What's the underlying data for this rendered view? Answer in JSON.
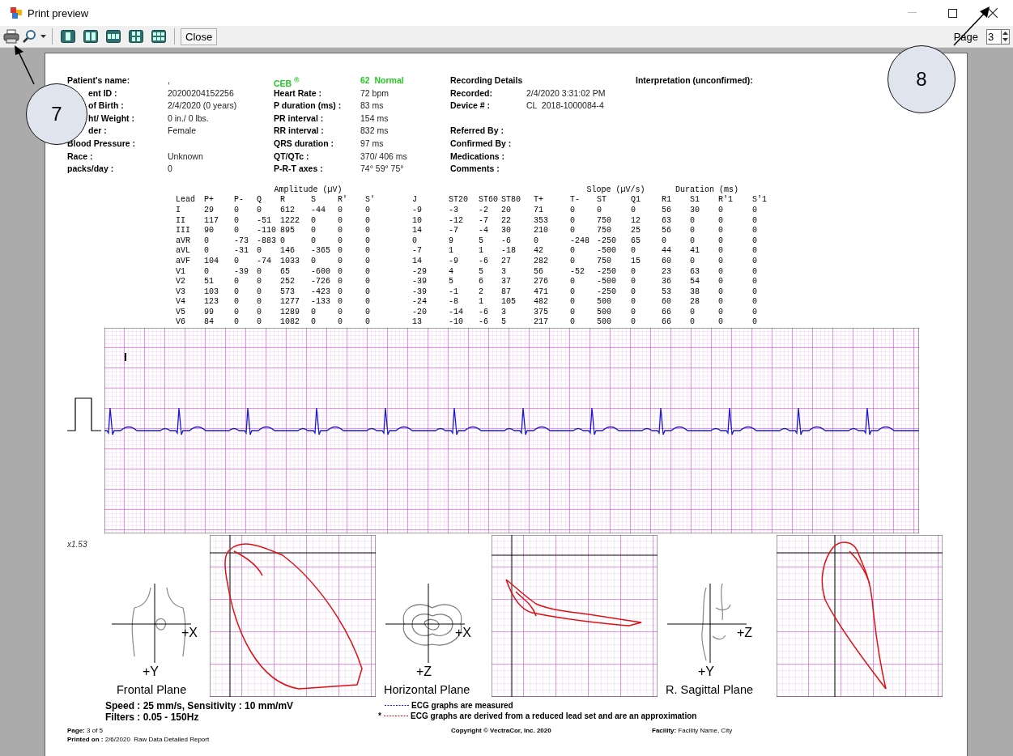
{
  "window": {
    "title": "Print preview"
  },
  "toolbar": {
    "close_label": "Close",
    "page_label": "Page",
    "page_value": "3"
  },
  "patient": {
    "rows": [
      {
        "label": "Patient's name:",
        "value": ",",
        "covered": false
      },
      {
        "label": "ent ID :",
        "value": "20200204152256",
        "covered": true
      },
      {
        "label": "of Birth :",
        "value": "2/4/2020 (0 years)",
        "covered": true
      },
      {
        "label": "ht/ Weight :",
        "value": "0 in./ 0 lbs.",
        "covered": true
      },
      {
        "label": "der :",
        "value": "Female",
        "covered": true
      },
      {
        "label": "Blood Pressure :",
        "value": "",
        "covered": false
      },
      {
        "label": "Race :",
        "value": "Unknown",
        "covered": false
      },
      {
        "label": "packs/day :",
        "value": "0",
        "covered": false
      }
    ]
  },
  "ecg_summary": {
    "title": "CEB $^{®}$",
    "status": "62  Normal",
    "rows": [
      {
        "label": "Heart Rate :",
        "value": "72 bpm"
      },
      {
        "label": "P duration (ms) :",
        "value": "83 ms"
      },
      {
        "label": "PR interval :",
        "value": "154 ms"
      },
      {
        "label": "RR interval :",
        "value": "832 ms"
      },
      {
        "label": "QRS duration :",
        "value": "97 ms"
      },
      {
        "label": "QT/QTc :",
        "value": "370/ 406 ms"
      },
      {
        "label": "P-R-T axes :",
        "value": "74° 59° 75°"
      }
    ]
  },
  "recording": {
    "title": "Recording Details",
    "rows": [
      {
        "label": "Recorded:",
        "value": "2/4/2020 3:31:02 PM"
      },
      {
        "label": "Device # :",
        "value": "CL  2018-1000084-4"
      }
    ],
    "other_labels": [
      "Referred By :",
      "Confirmed By :",
      "Medications :",
      "Comments :"
    ]
  },
  "interpretation": {
    "title": "Interpretation (unconfirmed):"
  },
  "table": {
    "groups": [
      "Amplitude (µV)",
      "Slope (µV/s)",
      "Duration (ms)"
    ],
    "columns": [
      "Lead",
      "P+",
      "P-",
      "Q",
      "R",
      "S",
      "R'",
      "S'",
      "J",
      "ST20",
      "ST60",
      "ST80",
      "T+",
      "T-",
      "ST",
      "Q1",
      "R1",
      "S1",
      "R'1",
      "S'1"
    ],
    "rows": [
      [
        "I",
        "29",
        "0",
        "0",
        "612",
        "-44",
        "0",
        "0",
        "-9",
        "-3",
        "-2",
        "20",
        "71",
        "0",
        "0",
        "0",
        "56",
        "30",
        "0",
        "0"
      ],
      [
        "II",
        "117",
        "0",
        "-51",
        "1222",
        "0",
        "0",
        "0",
        "10",
        "-12",
        "-7",
        "22",
        "353",
        "0",
        "750",
        "12",
        "63",
        "0",
        "0",
        "0"
      ],
      [
        "III",
        "90",
        "0",
        "-110",
        "895",
        "0",
        "0",
        "0",
        "14",
        "-7",
        "-4",
        "30",
        "210",
        "0",
        "750",
        "25",
        "56",
        "0",
        "0",
        "0"
      ],
      [
        "aVR",
        "0",
        "-73",
        "-883",
        "0",
        "0",
        "0",
        "0",
        "0",
        "9",
        "5",
        "-6",
        "0",
        "-248",
        "-250",
        "65",
        "0",
        "0",
        "0",
        "0"
      ],
      [
        "aVL",
        "0",
        "-31",
        "0",
        "146",
        "-365",
        "0",
        "0",
        "-7",
        "1",
        "1",
        "-18",
        "42",
        "0",
        "-500",
        "0",
        "44",
        "41",
        "0",
        "0"
      ],
      [
        "aVF",
        "104",
        "0",
        "-74",
        "1033",
        "0",
        "0",
        "0",
        "14",
        "-9",
        "-6",
        "27",
        "282",
        "0",
        "750",
        "15",
        "60",
        "0",
        "0",
        "0"
      ],
      [
        "V1",
        "0",
        "-39",
        "0",
        "65",
        "-600",
        "0",
        "0",
        "-29",
        "4",
        "5",
        "3",
        "56",
        "-52",
        "-250",
        "0",
        "23",
        "63",
        "0",
        "0"
      ],
      [
        "V2",
        "51",
        "0",
        "0",
        "252",
        "-726",
        "0",
        "0",
        "-39",
        "5",
        "6",
        "37",
        "276",
        "0",
        "-500",
        "0",
        "36",
        "54",
        "0",
        "0"
      ],
      [
        "V3",
        "103",
        "0",
        "0",
        "573",
        "-423",
        "0",
        "0",
        "-39",
        "-1",
        "2",
        "87",
        "471",
        "0",
        "-250",
        "0",
        "53",
        "38",
        "0",
        "0"
      ],
      [
        "V4",
        "123",
        "0",
        "0",
        "1277",
        "-133",
        "0",
        "0",
        "-24",
        "-8",
        "1",
        "105",
        "482",
        "0",
        "500",
        "0",
        "60",
        "28",
        "0",
        "0"
      ],
      [
        "V5",
        "99",
        "0",
        "0",
        "1289",
        "0",
        "0",
        "0",
        "-20",
        "-14",
        "-6",
        "3",
        "375",
        "0",
        "500",
        "0",
        "66",
        "0",
        "0",
        "0"
      ],
      [
        "V6",
        "84",
        "0",
        "0",
        "1082",
        "0",
        "0",
        "0",
        "13",
        "-10",
        "-6",
        "5",
        "217",
        "0",
        "500",
        "0",
        "66",
        "0",
        "0",
        "0"
      ]
    ]
  },
  "strip": {
    "lead_label": "I"
  },
  "scale": "x1.53",
  "planes": [
    {
      "kind": "frontal",
      "name": "Frontal Plane",
      "axis_h": "+X",
      "axis_v": "+Y"
    },
    {
      "kind": "horizontal",
      "name": "Horizontal Plane",
      "axis_h": "+X",
      "axis_v": "+Z"
    },
    {
      "kind": "sagittal",
      "name": "R. Sagittal Plane",
      "axis_h": "+Z",
      "axis_v": "+Y"
    }
  ],
  "settings": {
    "speed": "Speed : 25 mm/s, Sensitivity : 10 mm/mV",
    "filters": "Filters : 0.05 - 150Hz"
  },
  "legend": [
    {
      "kind": "measured",
      "text": "ECG graphs are measured"
    },
    {
      "kind": "derived",
      "mark": "*",
      "text": "ECG graphs are derived from a reduced lead set and are an approximation"
    }
  ],
  "footer": {
    "page_label": "Page:",
    "page_value": "3 of 5",
    "printed_label": "Printed on :",
    "printed_value": "2/6/2020  Raw Data Detailed Report",
    "copyright": "Copyright © VectraCor, Inc. 2020",
    "facility_label": "Facility:",
    "facility_value": "Facility Name, City"
  },
  "callouts": [
    "7",
    "8"
  ]
}
